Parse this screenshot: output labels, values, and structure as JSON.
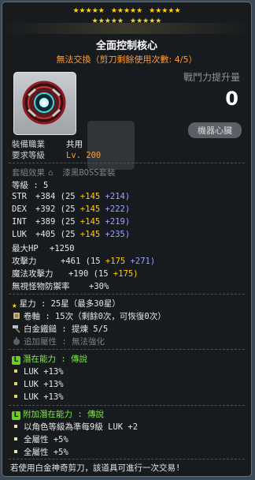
{
  "item": {
    "title": "全面控制核心",
    "subtitle": "無法交換（剪刀剩餘使用次數: 4/5）",
    "star_rows": 2,
    "damage_label": "戰鬥力提升量",
    "damage_value": "0",
    "category_badge": "機器心臟"
  },
  "requirements": {
    "job_label": "裝備職業",
    "job_value": "共用",
    "level_label": "要求等級",
    "level_value": "Lv. 200"
  },
  "set": {
    "label": "套組效果",
    "value": "漆黑BOSS套裝"
  },
  "grade": "等級 : 5",
  "stats": [
    {
      "name": "STR",
      "total": "+384",
      "open": "(25",
      "add": "+145",
      "bonus": "+214)"
    },
    {
      "name": "DEX",
      "total": "+392",
      "open": "(25",
      "add": "+145",
      "bonus": "+222)"
    },
    {
      "name": "INT",
      "total": "+389",
      "open": "(25",
      "add": "+145",
      "bonus": "+219)"
    },
    {
      "name": "LUK",
      "total": "+405",
      "open": "(25",
      "add": "+145",
      "bonus": "+235)"
    }
  ],
  "hp": {
    "name": "最大HP",
    "value": "+1250"
  },
  "attack": {
    "name": "攻擊力",
    "total": "+461",
    "open": "(15",
    "add": "+175",
    "bonus": "+271)"
  },
  "magic": {
    "name": "魔法攻擊力",
    "total": "+190",
    "open": "(15",
    "add": "+175)"
  },
  "ignore_def": {
    "name": "無視怪物防禦率",
    "value": "+30%"
  },
  "upgrades": {
    "star": "星力 : 25星（最多30星）",
    "scroll": "卷軸 : 15次（剩餘0次，可恢復0次）",
    "hammer": "白金鐵鎚 : 提煉 5/5",
    "extra": "追加屬性 : 無法強化"
  },
  "potential": {
    "header": "潛在能力 : 傳說",
    "lines": [
      "LUK +13%",
      "LUK +13%",
      "LUK +13%"
    ]
  },
  "bonus_potential": {
    "header": "附加潛在能力 : 傳說",
    "lines": [
      "以角色等級為準每9級 LUK +2",
      "全屬性 +5%",
      "全屬性 +5%"
    ]
  },
  "footer": "若使用白金神奇剪刀，該道具可進行一次交易!",
  "colors": {
    "accent_orange": "#ff9a33",
    "legend_green": "#6bcf2a",
    "star_yellow": "#ffd21a"
  }
}
